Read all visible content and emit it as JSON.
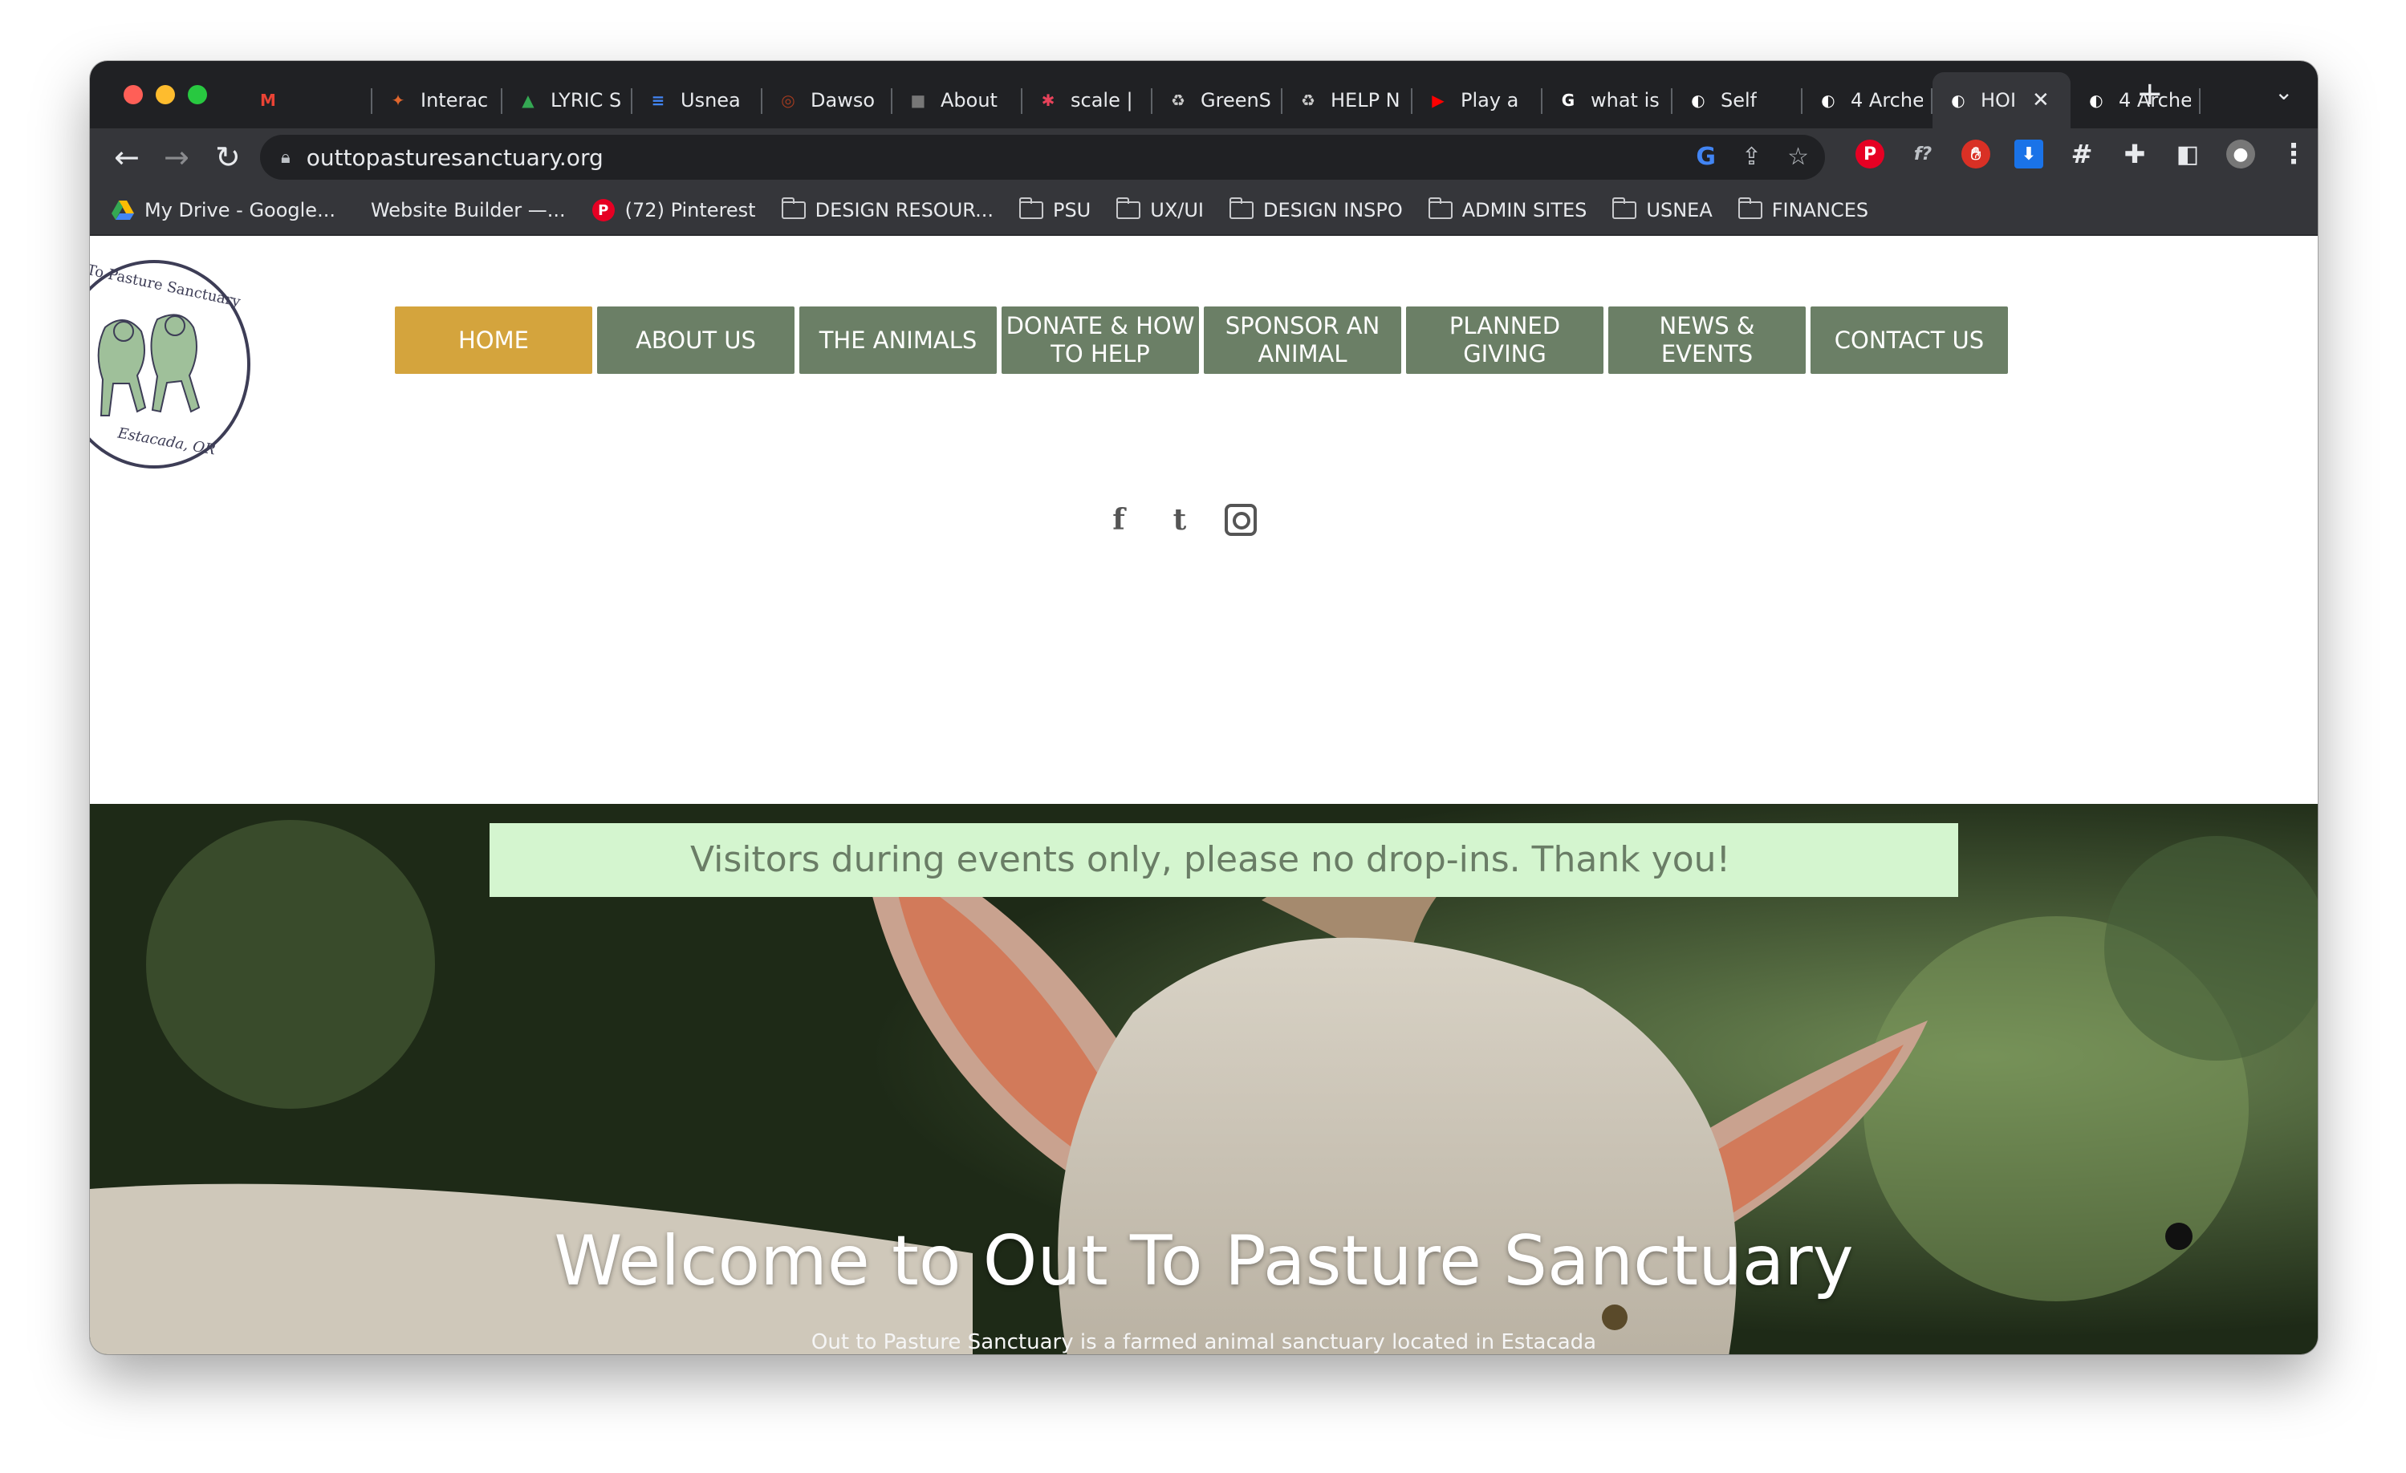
{
  "browser": {
    "tabs": [
      {
        "label": "",
        "icon": "gmail-icon",
        "color": "#ea4335",
        "glyph": "M"
      },
      {
        "label": "Interac",
        "icon": "bird-icon",
        "color": "#e0662d",
        "glyph": "✦"
      },
      {
        "label": "LYRIC S",
        "icon": "drive-icon",
        "color": "#34a853",
        "glyph": "▲"
      },
      {
        "label": "Usnea",
        "icon": "docs-icon",
        "color": "#4285f4",
        "glyph": "≡"
      },
      {
        "label": "Dawso",
        "icon": "dawson-icon",
        "color": "#a33b1f",
        "glyph": "◎"
      },
      {
        "label": "About",
        "icon": "cube-icon",
        "color": "#777777",
        "glyph": "■"
      },
      {
        "label": "scale |",
        "icon": "asterisk-icon",
        "color": "#e8425a",
        "glyph": "✱"
      },
      {
        "label": "GreenS",
        "icon": "recycle-icon",
        "color": "#cccccc",
        "glyph": "♻"
      },
      {
        "label": "HELP N",
        "icon": "recycle-icon",
        "color": "#cccccc",
        "glyph": "♻"
      },
      {
        "label": "Play a",
        "icon": "youtube-icon",
        "color": "#ff0000",
        "glyph": "▶"
      },
      {
        "label": "what is",
        "icon": "google-icon",
        "color": "#ffffff",
        "glyph": "G"
      },
      {
        "label": "Self",
        "icon": "globe-icon",
        "color": "#ffffff",
        "glyph": "◐"
      },
      {
        "label": "4 Arche",
        "icon": "globe-icon",
        "color": "#ffffff",
        "glyph": "◐"
      },
      {
        "label": "HOI",
        "icon": "globe-icon",
        "color": "#ffffff",
        "glyph": "◐",
        "active": true
      },
      {
        "label": "4 Arche",
        "icon": "globe-icon",
        "color": "#ffffff",
        "glyph": "◐"
      }
    ],
    "new_tab": "+",
    "tab_menu": "⌄",
    "url": "outtopasturesanctuary.org",
    "bookmarks": [
      {
        "label": "My Drive - Google...",
        "icon": "drive-icon"
      },
      {
        "label": "Website Builder —...",
        "icon": "blank-icon"
      },
      {
        "label": "(72) Pinterest",
        "icon": "pinterest-icon"
      },
      {
        "label": "DESIGN RESOUR...",
        "icon": "folder-icon"
      },
      {
        "label": "PSU",
        "icon": "folder-icon"
      },
      {
        "label": "UX/UI",
        "icon": "folder-icon"
      },
      {
        "label": "DESIGN INSPO",
        "icon": "folder-icon"
      },
      {
        "label": "ADMIN SITES",
        "icon": "folder-icon"
      },
      {
        "label": "USNEA",
        "icon": "folder-icon"
      },
      {
        "label": "FINANCES",
        "icon": "folder-icon"
      }
    ]
  },
  "site": {
    "logo": {
      "top_text": "To Pasture Sanctuary",
      "bottom_text": "Estacada, OR"
    },
    "nav": [
      {
        "label": "HOME",
        "active": true
      },
      {
        "label": "ABOUT US"
      },
      {
        "label": "THE ANIMALS"
      },
      {
        "label": "DONATE & HOW TO HELP"
      },
      {
        "label": "SPONSOR AN ANIMAL"
      },
      {
        "label": "PLANNED GIVING"
      },
      {
        "label": "NEWS & EVENTS"
      },
      {
        "label": "CONTACT US"
      }
    ],
    "social": [
      {
        "icon": "facebook-icon",
        "glyph": "f"
      },
      {
        "icon": "tumblr-icon",
        "glyph": "t"
      },
      {
        "icon": "instagram-icon",
        "glyph": ""
      }
    ],
    "notice": "Visitors during events only, please no drop-ins. Thank you!",
    "hero_title": "Welcome to Out To Pasture Sanctuary",
    "hero_subtitle": "Out to Pasture Sanctuary is a farmed animal sanctuary located in Estacada",
    "colors": {
      "nav_green": "#6b7f66",
      "nav_active": "#d4a43d",
      "notice_bg": "#d4f5cf"
    }
  }
}
